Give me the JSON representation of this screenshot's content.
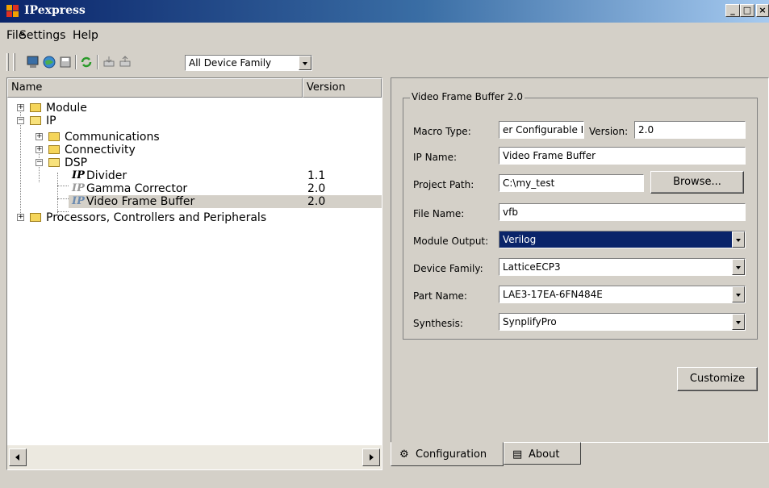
{
  "window": {
    "title": "IPexpress",
    "min": "_",
    "max": "□",
    "close": "×"
  },
  "menu": {
    "file": "File",
    "settings": "Settings",
    "help": "Help"
  },
  "toolbar": {
    "family_filter": "All Device Family"
  },
  "columns": {
    "name": "Name",
    "version": "Version"
  },
  "tree": {
    "module": "Module",
    "ip": "IP",
    "communications": "Communications",
    "connectivity": "Connectivity",
    "dsp": "DSP",
    "divider": {
      "label": "Divider",
      "version": "1.1"
    },
    "gamma": {
      "label": "Gamma Corrector",
      "version": "2.0"
    },
    "vfb": {
      "label": "Video Frame Buffer",
      "version": "2.0"
    },
    "processors": "Processors, Controllers and Peripherals",
    "ip_icon": "IP"
  },
  "config": {
    "group_title": "Video Frame Buffer 2.0",
    "macro_type_label": "Macro Type:",
    "macro_type_value": "er Configurable IP",
    "version_label": "Version:",
    "version_value": "2.0",
    "ip_name_label": "IP Name:",
    "ip_name_value": "Video Frame Buffer",
    "project_path_label": "Project Path:",
    "project_path_value": "C:\\my_test",
    "browse_label": "Browse...",
    "file_name_label": "File Name:",
    "file_name_value": "vfb",
    "module_output_label": "Module Output:",
    "module_output_value": "Verilog",
    "device_family_label": "Device Family:",
    "device_family_value": "LatticeECP3",
    "part_name_label": "Part Name:",
    "part_name_value": "LAE3-17EA-6FN484E",
    "synthesis_label": "Synthesis:",
    "synthesis_value": "SynplifyPro",
    "customize_label": "Customize"
  },
  "tabs": {
    "configuration": "Configuration",
    "about": "About"
  }
}
